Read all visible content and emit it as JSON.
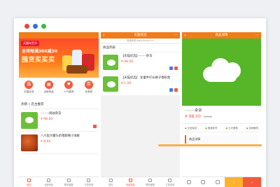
{
  "screen1": {
    "banner": {
      "tag": "天猫年货节",
      "line1": "全场每满300减30",
      "line2": "囤货买买买"
    },
    "categories": [
      {
        "label": "天猫优选",
        "icon": "tmall-icon"
      },
      {
        "label": "全部商品",
        "icon": "grid-icon"
      },
      {
        "label": "人气推荐",
        "icon": "heart-icon"
      },
      {
        "label": "优惠券",
        "icon": "coupon-icon"
      }
    ],
    "section_title": "热销 • 店主推荐",
    "items": [
      {
        "name": "·········网站杂货",
        "price": "¥ 98.00"
      },
      {
        "name": "八爪鱼大鳗头奶夜鲜辣小海鲜",
        "price": "¥ 8.00"
      }
    ],
    "tabs": [
      "首页",
      "全部商品",
      "联系客服",
      "订单查询"
    ]
  },
  "screen2": {
    "title": "天猫优选",
    "url": "普通商城 www.xxxxxx.cn",
    "list_title": "商品列表",
    "items": [
      {
        "name": "【天猫优选】·········杂货",
        "price": "¥ 98.00"
      },
      {
        "name": "【天猫优选】 女童牛仔长裤子春秋款",
        "price": "¥ 1.00"
      }
    ],
    "tabs": [
      "首页",
      "全部商品",
      "联系客服",
      "订单查询"
    ]
  },
  "screen3": {
    "title": "商品详情",
    "product_name": "·········杂货",
    "price": "¥ 98.00",
    "original_price": "¥ 1.00",
    "features": [
      "正品保证",
      "极速发货",
      "七天退换",
      "全网最低"
    ],
    "detail_title": "商品详情"
  },
  "colors": {
    "header": "#f07c1a",
    "accent": "#f35a3c",
    "green": "#57b528"
  }
}
